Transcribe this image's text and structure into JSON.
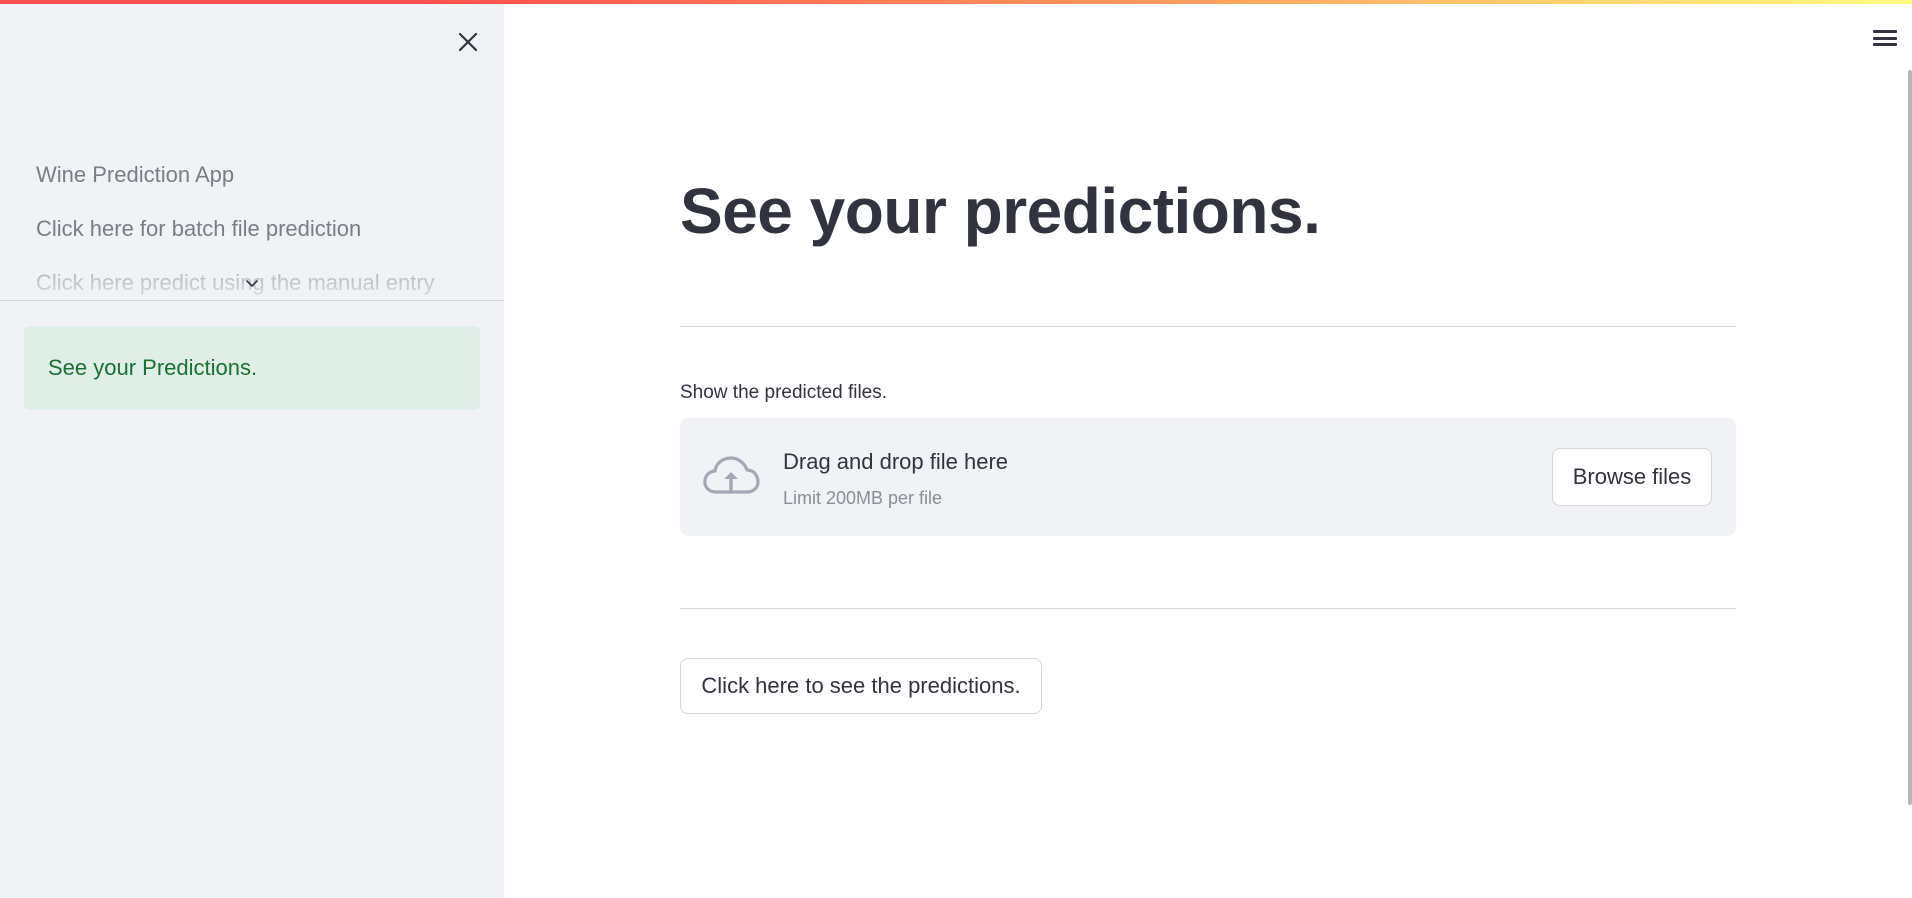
{
  "theme": {
    "sidebar_bg": "#f0f2f6",
    "text": "#31333f",
    "alert_bg": "#dfeee7",
    "alert_text": "#177233",
    "top_gradient": [
      "#ff4b4b",
      "#fd9a5b",
      "#fffd80"
    ]
  },
  "sidebar": {
    "close_icon": "close-icon",
    "nav_items": [
      {
        "label": "Wine Prediction App"
      },
      {
        "label": "Click here for batch file prediction"
      },
      {
        "label": "Click here predict using the manual entry"
      }
    ],
    "expand_icon": "chevron-down-icon",
    "alert": {
      "text": "See your Predictions."
    }
  },
  "header": {
    "menu_icon": "hamburger-menu-icon"
  },
  "main": {
    "title": "See your predictions.",
    "uploader": {
      "label": "Show the predicted files.",
      "icon": "cloud-upload-icon",
      "instructions": "Drag and drop file here",
      "limit": "Limit 200MB per file",
      "browse_label": "Browse files"
    },
    "predict_button_label": "Click here to see the predictions."
  }
}
